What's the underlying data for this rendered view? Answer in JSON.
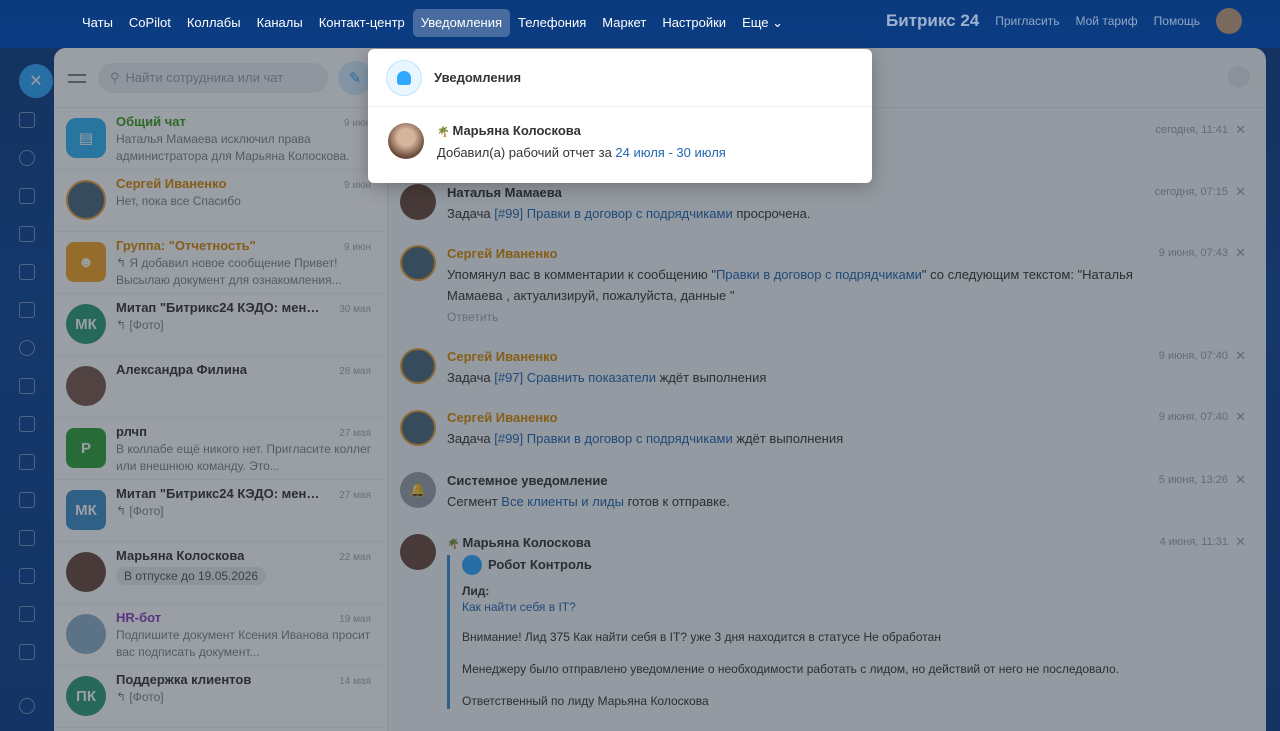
{
  "topnav": [
    "Чаты",
    "CoPilot",
    "Коллабы",
    "Каналы",
    "Контакт-центр",
    "Уведомления",
    "Телефония",
    "Маркет",
    "Настройки",
    "Еще"
  ],
  "topright": {
    "brand": "Битрикс 24",
    "invite": "Пригласить",
    "tariff": "Мой тариф",
    "help": "Помощь"
  },
  "search": {
    "placeholder": "Найти сотрудника или чат"
  },
  "chats": [
    {
      "title": "Общий чат",
      "preview": "Наталья Мамаева исключил права администратора для Марьяна Колоскова.",
      "date": "9 июн"
    },
    {
      "title": "Сергей Иваненко",
      "preview": "Нет, пока все Спасибо",
      "date": "9 июн"
    },
    {
      "title": "Группа: \"Отчетность\"",
      "preview": "↰ Я добавил новое сообщение Привет! Высылаю документ для ознакомления...",
      "date": "9 июн"
    },
    {
      "title": "Митап \"Битрикс24 КЭДО: меньш...",
      "preview": "↰ [Фото]",
      "date": "30 мая",
      "initials": "МК"
    },
    {
      "title": "Александра Филина",
      "preview": "",
      "date": "28 мая"
    },
    {
      "title": "рлчп",
      "preview": "В коллабе ещё никого нет. Пригласите коллег или внешнюю команду. Это...",
      "date": "27 мая",
      "initials": "Р"
    },
    {
      "title": "Митап \"Битрикс24 КЭДО: меньш...",
      "preview": "↰ [Фото]",
      "date": "27 мая",
      "initials": "МК"
    },
    {
      "title": "Марьяна Колоскова",
      "preview": "В отпуске до 19.05.2026",
      "date": "22 мая"
    },
    {
      "title": "HR-бот",
      "preview": "Подпишите документ Ксения Иванова просит вас подписать документ...",
      "date": "19 мая"
    },
    {
      "title": "Поддержка клиентов",
      "preview": "↰ [Фото]",
      "date": "14 мая",
      "initials": "ПК"
    }
  ],
  "notifications": [
    {
      "author": "Марьяна Колоскова",
      "date": "сегодня, 11:41"
    },
    {
      "author": "Наталья Мамаева",
      "text_before": "Задача ",
      "link": "[#99] Правки в договор с подрядчиками",
      "text_after": " просрочена.",
      "date": "сегодня, 07:15"
    },
    {
      "author": "Сергей Иваненко",
      "text_before": "Упомянул вас в комментарии к сообщению \"",
      "link": "Правки в договор с подрядчиками",
      "text_after": "\" со следующим текстом: \"Наталья Мамаева , актуализируй, пожалуйста, данные \"",
      "answer": "Ответить",
      "date": "9 июня, 07:43"
    },
    {
      "author": "Сергей Иваненко",
      "text_before": "Задача ",
      "link": "[#97] Сравнить показатели",
      "text_after": " ждёт выполнения",
      "date": "9 июня, 07:40"
    },
    {
      "author": "Сергей Иваненко",
      "text_before": "Задача ",
      "link": "[#99] Правки в договор с подрядчиками",
      "text_after": " ждёт выполнения",
      "date": "9 июня, 07:40"
    },
    {
      "author": "Системное уведомление",
      "text_before": "Сегмент ",
      "link": "Все клиенты и лиды",
      "text_after": " готов к отправке.",
      "date": "5 июня, 13:26"
    },
    {
      "author": "Марьяна Колоскова",
      "date": "4 июня, 11:31"
    }
  ],
  "robot": {
    "name": "Робот Контроль",
    "lead_label": "Лид:",
    "lead_link": "Как найти себя в IT?",
    "line1": "Внимание! Лид 375 Как найти себя в IT? уже 3 дня находится в статусе Не обработан",
    "line2": "Менеджеру было отправлено уведомление о необходимости работать с лидом, но действий от него не последовало.",
    "line3": "Ответственный по лиду Марьяна Колоскова"
  },
  "popup": {
    "title": "Уведомления",
    "author": "Марьяна Колоскова",
    "text": "Добавил(а) рабочий отчет за ",
    "link": "24 июля - 30 июля"
  },
  "colors": {
    "accent": "#2fa8ff",
    "link": "#2067b0",
    "green": "#3a9e1e",
    "orange": "#d98a00"
  }
}
